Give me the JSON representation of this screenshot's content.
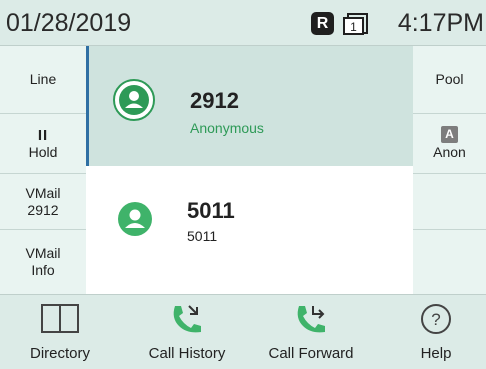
{
  "status": {
    "date": "01/28/2019",
    "time": "4:17PM",
    "badge": "R",
    "line_indicator": "1"
  },
  "left_keys": [
    {
      "label1": "Line",
      "label2": ""
    },
    {
      "label1": "II",
      "label2": "Hold"
    },
    {
      "label1": "VMail",
      "label2": "2912"
    },
    {
      "label1": "VMail",
      "label2": "Info"
    }
  ],
  "right_keys": [
    {
      "label1": "Pool",
      "label2": ""
    },
    {
      "badge": "A",
      "label2": "Anon"
    },
    {
      "label1": "",
      "label2": ""
    },
    {
      "label1": "",
      "label2": ""
    }
  ],
  "lines": [
    {
      "number": "2912",
      "name": "Anonymous"
    },
    {
      "number": "5011",
      "name": "5011"
    }
  ],
  "bottom": [
    "Directory",
    "Call History",
    "Call Forward",
    "Help"
  ],
  "colors": {
    "accent_green": "#2e9a57",
    "highlight": "#cfe3de",
    "panel": "#dcebe7"
  },
  "icons": [
    "book-icon",
    "call-history-icon",
    "call-forward-icon",
    "help-icon",
    "user-icon"
  ]
}
